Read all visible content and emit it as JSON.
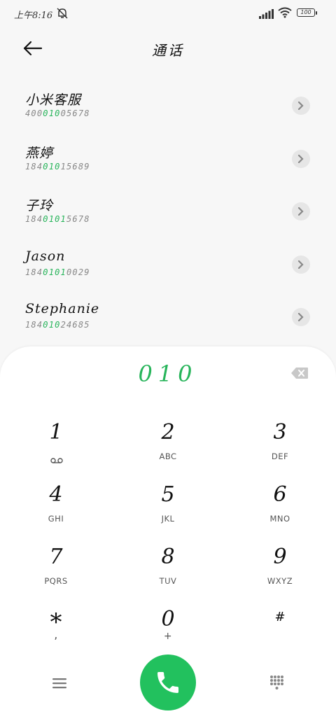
{
  "status_bar": {
    "time": "上午8:16",
    "battery": "100"
  },
  "header": {
    "title": "通话"
  },
  "contacts": [
    {
      "name": "小米客服",
      "num_pre": "400",
      "num_match": "010",
      "num_post": "05678"
    },
    {
      "name": "燕婷",
      "num_pre": "184",
      "num_match": "010",
      "num_post": "15689"
    },
    {
      "name": "子玲",
      "num_pre": "184",
      "num_match": "0101",
      "num_post": "5678"
    },
    {
      "name": "Jason",
      "num_pre": "184",
      "num_match": "0101",
      "num_post": "0029"
    },
    {
      "name": "Stephanie",
      "num_pre": "184",
      "num_match": "010",
      "num_post": "24685"
    }
  ],
  "dialer": {
    "display": "010",
    "keys": [
      {
        "digit": "1",
        "letters": ""
      },
      {
        "digit": "2",
        "letters": "ABC"
      },
      {
        "digit": "3",
        "letters": "DEF"
      },
      {
        "digit": "4",
        "letters": "GHI"
      },
      {
        "digit": "5",
        "letters": "JKL"
      },
      {
        "digit": "6",
        "letters": "MNO"
      },
      {
        "digit": "7",
        "letters": "PQRS"
      },
      {
        "digit": "8",
        "letters": "TUV"
      },
      {
        "digit": "9",
        "letters": "WXYZ"
      },
      {
        "digit": "*",
        "letters": ","
      },
      {
        "digit": "0",
        "letters": "+"
      },
      {
        "digit": "#",
        "letters": ""
      }
    ]
  },
  "icons": {
    "back": "arrow-left-icon",
    "mute": "bell-off-icon",
    "delete": "backspace-icon",
    "voicemail": "voicemail-icon",
    "menu": "menu-icon",
    "call": "phone-icon",
    "keypad": "dialpad-icon"
  },
  "colors": {
    "accent": "#27b45a",
    "call_button": "#22c15e"
  }
}
